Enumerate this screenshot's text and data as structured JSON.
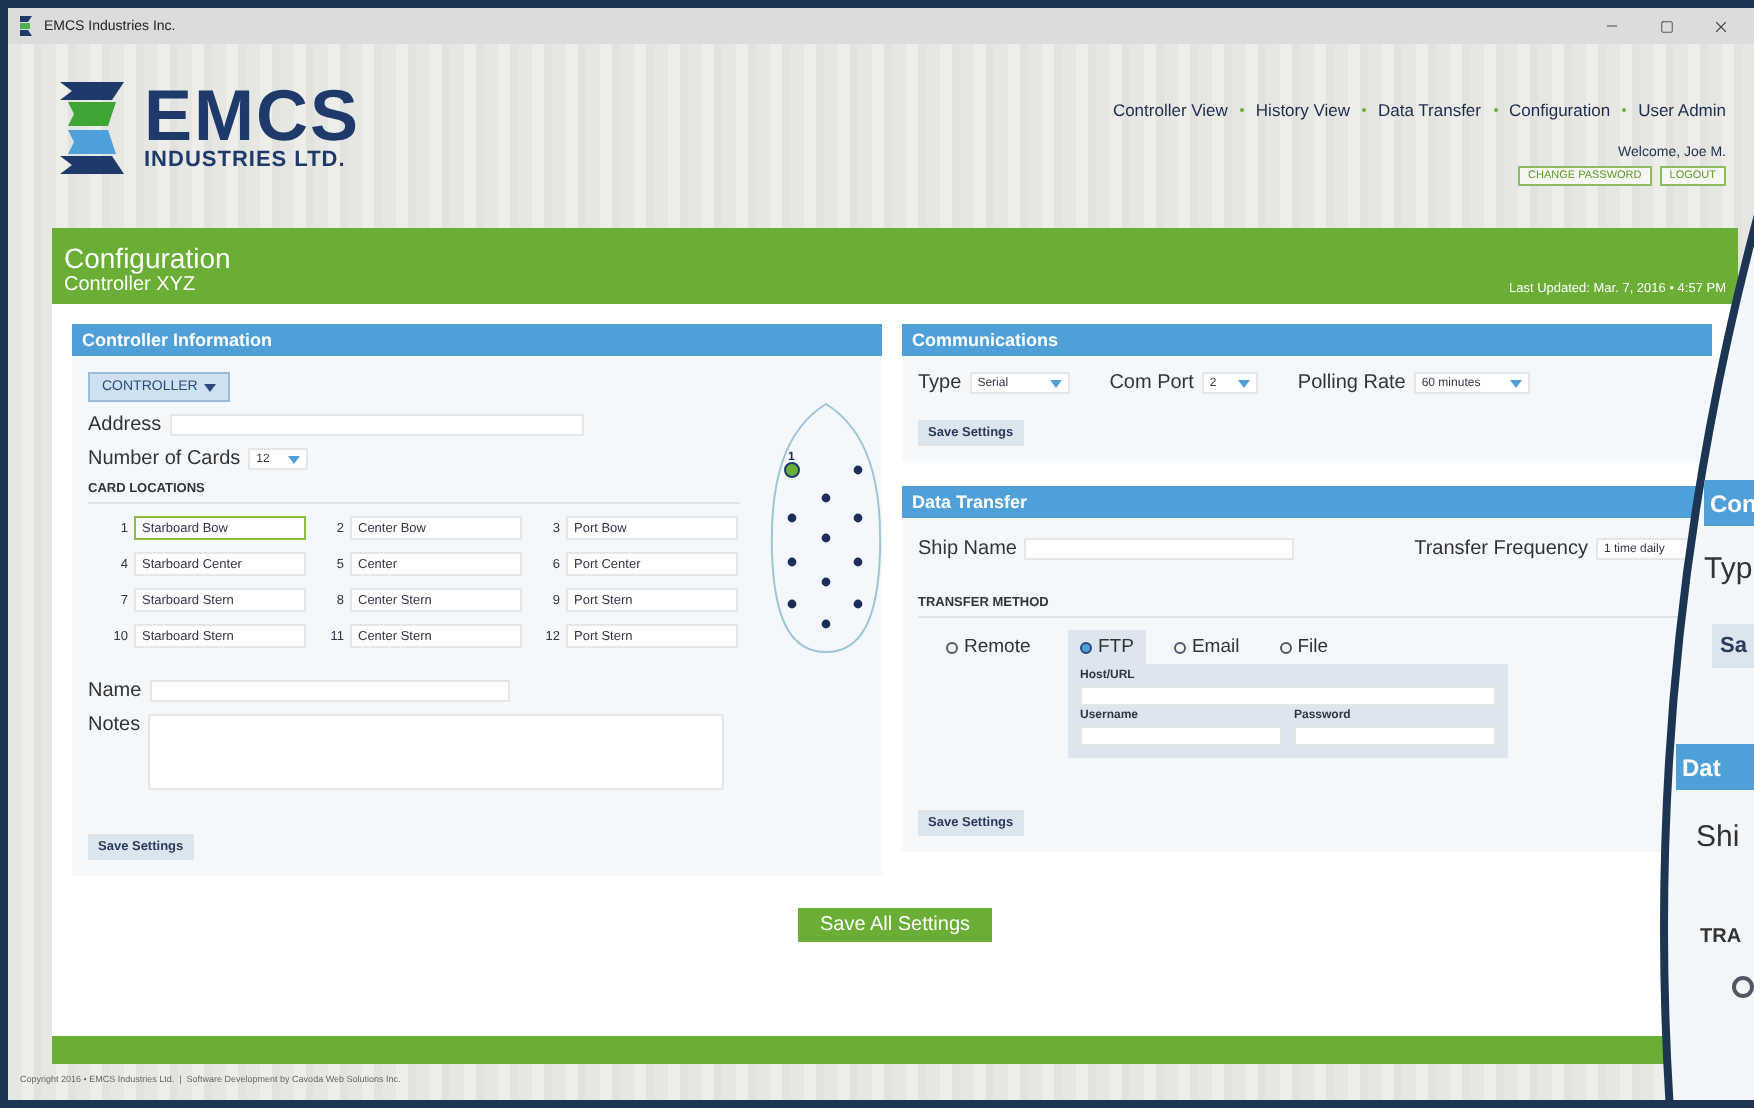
{
  "window": {
    "title": "EMCS Industries Inc."
  },
  "logo": {
    "name": "EMCS",
    "tagline": "INDUSTRIES LTD."
  },
  "nav": [
    "Controller View",
    "History View",
    "Data Transfer",
    "Configuration",
    "User Admin"
  ],
  "user": {
    "welcome": "Welcome, Joe M.",
    "buttons": [
      "CHANGE PASSWORD",
      "LOGOUT"
    ]
  },
  "page": {
    "title": "Configuration",
    "subtitle": "Controller XYZ",
    "last_updated": "Last Updated: Mar. 7, 2016 • 4:57 PM"
  },
  "controller_info": {
    "title": "Controller Information",
    "type_button": "CONTROLLER",
    "address_label": "Address",
    "cards_label": "Number of Cards",
    "cards_value": "12",
    "locations_title": "CARD LOCATIONS",
    "cards": [
      {
        "number": "1",
        "name": "Starboard Bow",
        "selected": true
      },
      {
        "number": "2",
        "name": "Center Bow",
        "selected": false
      },
      {
        "number": "3",
        "name": "Port Bow",
        "selected": false
      },
      {
        "number": "4",
        "name": "Starboard Center",
        "selected": false
      },
      {
        "number": "5",
        "name": "Center",
        "selected": false
      },
      {
        "number": "6",
        "name": "Port Center",
        "selected": false
      },
      {
        "number": "7",
        "name": "Starboard Stern",
        "selected": false
      },
      {
        "number": "8",
        "name": "Center Stern",
        "selected": false
      },
      {
        "number": "9",
        "name": "Port Stern",
        "selected": false
      },
      {
        "number": "10",
        "name": "Starboard Stern",
        "selected": false
      },
      {
        "number": "11",
        "name": "Center Stern",
        "selected": false
      },
      {
        "number": "12",
        "name": "Port Stern",
        "selected": false
      }
    ],
    "boat": {
      "marker_label": "1"
    },
    "name_label": "Name",
    "notes_label": "Notes",
    "save": "Save Settings"
  },
  "communications": {
    "title": "Communications",
    "fields": [
      {
        "label": "Type",
        "value": "Serial"
      },
      {
        "label": "Com Port",
        "value": "2"
      },
      {
        "label": "Polling Rate",
        "value": "60 minutes"
      }
    ],
    "save": "Save Settings"
  },
  "data_transfer": {
    "title": "Data Transfer",
    "ship_label": "Ship Name",
    "frequency_label": "Transfer Frequency",
    "frequency_value": "1 time daily",
    "method_title": "TRANSFER METHOD",
    "methods": [
      {
        "label": "Remote",
        "selected": false
      },
      {
        "label": "FTP",
        "selected": true
      },
      {
        "label": "Email",
        "selected": false
      },
      {
        "label": "File",
        "selected": false
      }
    ],
    "ftp": {
      "host_label": "Host/URL",
      "username_label": "Username",
      "password_label": "Password"
    },
    "save": "Save Settings"
  },
  "save_all": "Save All Settings",
  "footer": {
    "copyright": "Copyright 2016 • EMCS Industries Ltd.  |  Software Development by Cavoda Web Solutions Inc."
  },
  "magnifier": {
    "items": [
      {
        "kind": "header",
        "text": "Con"
      },
      {
        "kind": "label",
        "text": "Typ"
      },
      {
        "kind": "button",
        "text": "Sa"
      },
      {
        "kind": "header",
        "text": "Dat"
      },
      {
        "kind": "label",
        "text": "Shi"
      },
      {
        "kind": "section",
        "text": "TRA"
      },
      {
        "kind": "radio"
      }
    ]
  }
}
